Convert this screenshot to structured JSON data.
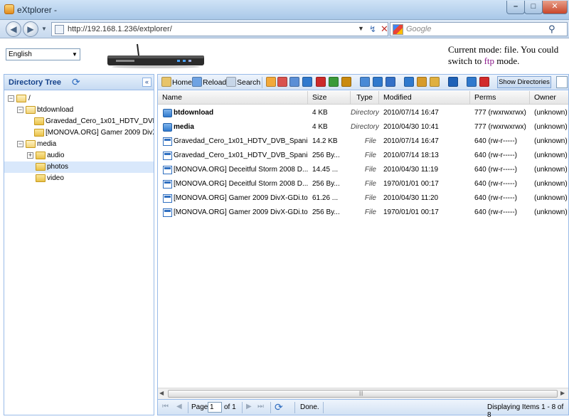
{
  "window": {
    "title": "eXtplorer -",
    "minimize": "–",
    "maximize": "□",
    "close": "✕"
  },
  "browser": {
    "url": "http://192.168.1.236/extplorer/",
    "search_placeholder": "Google",
    "back_icon": "◀",
    "forward_icon": "▶",
    "refresh_icon": "↯",
    "stop_icon": "✕",
    "search_icon": "⚲"
  },
  "header": {
    "language": "English",
    "mode_prefix": "Current mode: file. You could switch to ",
    "mode_link": "ftp",
    "mode_suffix": " mode."
  },
  "tree": {
    "title": "Directory Tree",
    "collapse_icon": "«",
    "refresh_icon": "⟳",
    "nodes": [
      {
        "label": "/",
        "expander": "−"
      },
      {
        "label": "btdownload",
        "expander": "−"
      },
      {
        "label": "Gravedad_Cero_1x01_HDTV_DVB_Spa"
      },
      {
        "label": "[MONOVA.ORG] Gamer 2009 DivX-GDi"
      },
      {
        "label": "media",
        "expander": "−"
      },
      {
        "label": "audio",
        "expander": "+"
      },
      {
        "label": "photos"
      },
      {
        "label": "video"
      }
    ]
  },
  "toolbar": {
    "home": "Home",
    "reload": "Reload",
    "search": "Search",
    "show_directories": "Show Directories",
    "icons": [
      "new-file-icon",
      "edit-icon",
      "copy-icon",
      "move-icon",
      "delete-icon",
      "rename-icon",
      "chmod-icon",
      "view-icon",
      "diff-icon",
      "download-icon",
      "upload-icon",
      "archive-icon",
      "extract-icon",
      "help-icon",
      "admin-icon",
      "logout-icon"
    ],
    "icon_colors": [
      "#f2a93b",
      "#d9534f",
      "#5b8fd6",
      "#2f79cd",
      "#cc2a2a",
      "#3a9a3a",
      "#c98a10",
      "#4a8ad6",
      "#2f79cd",
      "#3370c7",
      "#2f79cd",
      "#d79b2a",
      "#e0b040",
      "#1f62b8",
      "#2f79cd",
      "#d22b2b"
    ]
  },
  "grid": {
    "columns": {
      "name": "Name",
      "size": "Size",
      "type": "Type",
      "modified": "Modified",
      "perms": "Perms",
      "owner": "Owner"
    },
    "rows": [
      {
        "kind": "dir",
        "name": "btdownload",
        "size": "4 KB",
        "type": "Directory",
        "modified": "2010/07/14 16:47",
        "perms": "777 (rwxrwxrwx)",
        "owner": "(unknown)"
      },
      {
        "kind": "dir",
        "name": "media",
        "size": "4 KB",
        "type": "Directory",
        "modified": "2010/04/30 10:41",
        "perms": "777 (rwxrwxrwx)",
        "owner": "(unknown)"
      },
      {
        "kind": "file",
        "name": "Gravedad_Cero_1x01_HDTV_DVB_Spani...",
        "size": "14.2 KB",
        "type": "File",
        "modified": "2010/07/14 16:47",
        "perms": "640 (rw-r-----)",
        "owner": "(unknown)"
      },
      {
        "kind": "file",
        "name": "Gravedad_Cero_1x01_HDTV_DVB_Spani...",
        "size": "256 By...",
        "type": "File",
        "modified": "2010/07/14 18:13",
        "perms": "640 (rw-r-----)",
        "owner": "(unknown)"
      },
      {
        "kind": "file",
        "name": "[MONOVA.ORG] Deceitful Storm 2008 D...",
        "size": "14.45 ...",
        "type": "File",
        "modified": "2010/04/30 11:19",
        "perms": "640 (rw-r-----)",
        "owner": "(unknown)"
      },
      {
        "kind": "file",
        "name": "[MONOVA.ORG] Deceitful Storm 2008 D...",
        "size": "256 By...",
        "type": "File",
        "modified": "1970/01/01 00:17",
        "perms": "640 (rw-r-----)",
        "owner": "(unknown)"
      },
      {
        "kind": "file",
        "name": "[MONOVA.ORG] Gamer 2009 DivX-GDi.to...",
        "size": "61.26 ...",
        "type": "File",
        "modified": "2010/04/30 11:20",
        "perms": "640 (rw-r-----)",
        "owner": "(unknown)"
      },
      {
        "kind": "file",
        "name": "[MONOVA.ORG] Gamer 2009 DivX-GDi.to...",
        "size": "256 By...",
        "type": "File",
        "modified": "1970/01/01 00:17",
        "perms": "640 (rw-r-----)",
        "owner": "(unknown)"
      }
    ]
  },
  "pager": {
    "page_label": "Page",
    "page_value": "1",
    "of_label": "of 1",
    "status": "Done.",
    "display": "Displaying Items 1 - 8 of 8",
    "first_icon": "⏮",
    "prev_icon": "◀",
    "next_icon": "▶",
    "last_icon": "⏭",
    "refresh_icon": "⟳"
  }
}
